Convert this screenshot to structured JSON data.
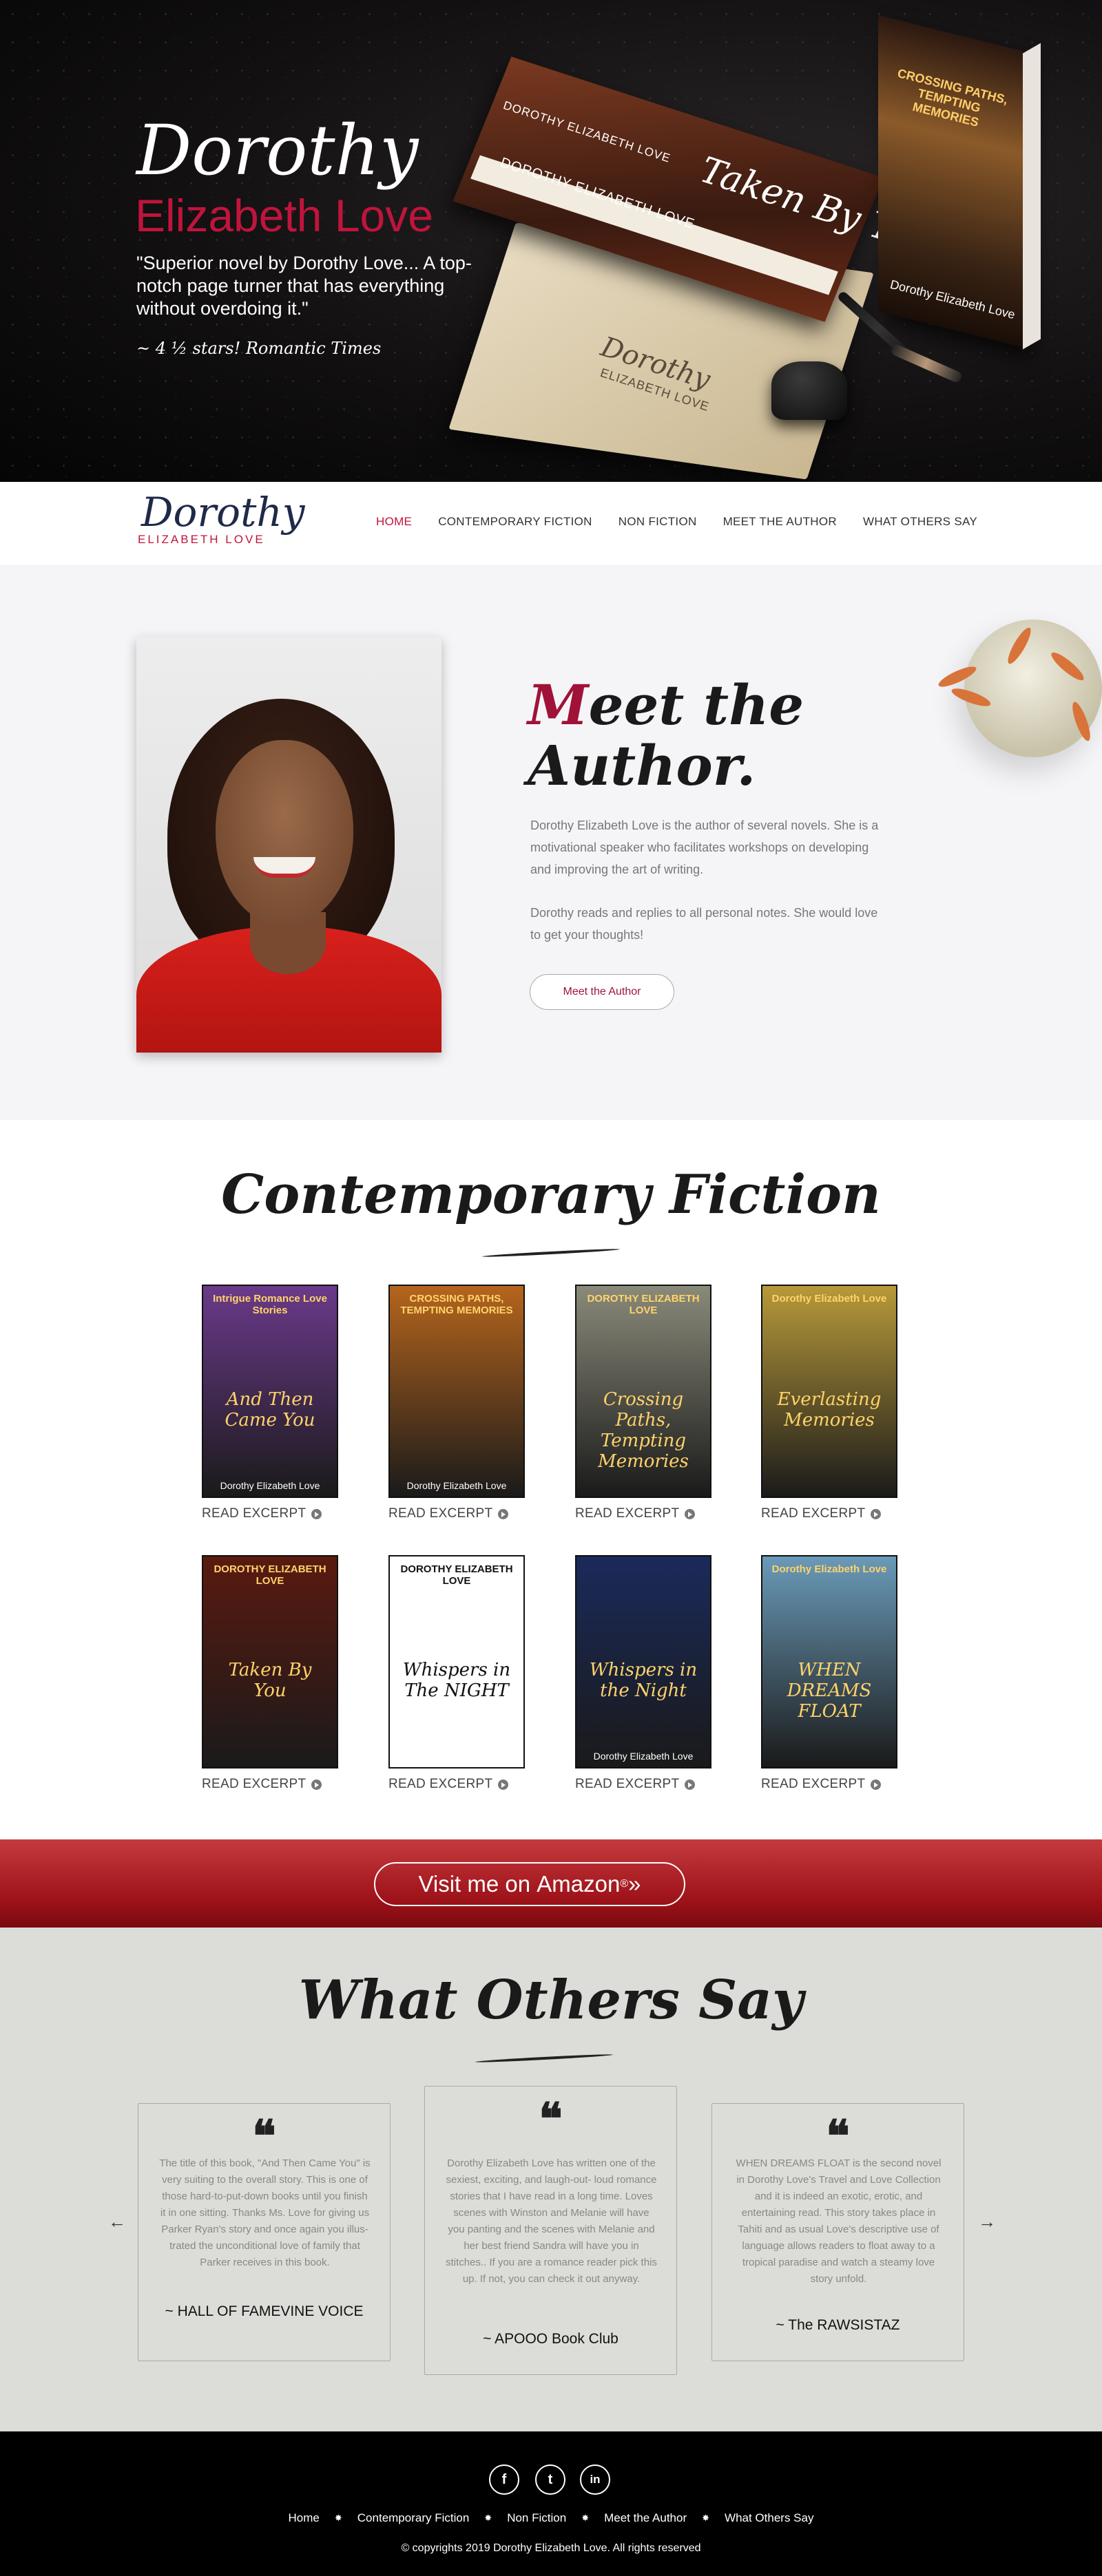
{
  "hero": {
    "title_line1": "Dorothy",
    "title_line2": "Elizabeth Love",
    "quote": "\"Superior novel by Dorothy Love... A top-notch page turner that has everything without overdoing it.\"",
    "citation": "~ 4 ½ stars! Romantic Times",
    "book_a_author_top": "DOROTHY ELIZABETH LOVE",
    "book_a_author_bottom": "DOROTHY ELIZABETH LOVE",
    "book_a_title": "Taken By You",
    "book_b_title": "CROSSING PATHS, TEMPTING MEMORIES",
    "book_b_author": "Dorothy Elizabeth Love",
    "envelope_sign": "Dorothy",
    "envelope_sub": "ELIZABETH LOVE"
  },
  "nav": {
    "logo_main": "Dorothy",
    "logo_sub": "ELIZABETH LOVE",
    "links": [
      "HOME",
      "CONTEMPORARY FICTION",
      "NON FICTION",
      "MEET THE AUTHOR",
      "WHAT OTHERS SAY"
    ],
    "active_index": 0
  },
  "meet": {
    "title_first_letter": "M",
    "title_rest_line1": "eet the",
    "title_line2": "Author.",
    "paragraph1": "Dorothy Elizabeth Love is the author of several novels. She is a motivational speaker who facilitates workshops on developing and improving the art of writing.",
    "paragraph2": "Dorothy reads and replies to all personal notes. She would love to get your thoughts!",
    "button_label": "Meet the Author"
  },
  "fiction": {
    "title": "Contemporary Fiction",
    "excerpt_label": "READ EXCERPT",
    "books": [
      {
        "top": "Intrigue Romance Love Stories",
        "title": "And Then Came You",
        "author": "Dorothy Elizabeth Love",
        "bg": "#6a3a8a"
      },
      {
        "top": "CROSSING PATHS, TEMPTING MEMORIES",
        "title": "",
        "author": "Dorothy Elizabeth Love",
        "bg": "#b5651d"
      },
      {
        "top": "DOROTHY ELIZABETH LOVE",
        "title": "Crossing Paths, Tempting Memories",
        "author": "",
        "bg": "#8a8a7a"
      },
      {
        "top": "Dorothy Elizabeth Love",
        "title": "Everlasting Memories",
        "author": "",
        "bg": "#b89a3a"
      },
      {
        "top": "DOROTHY ELIZABETH LOVE",
        "title": "Taken By You",
        "author": "",
        "bg": "#5a1a10"
      },
      {
        "top": "DOROTHY ELIZABETH LOVE",
        "title": "Whispers in The NIGHT",
        "author": "",
        "bg": "#ffffff"
      },
      {
        "top": "",
        "title": "Whispers in the Night",
        "author": "Dorothy Elizabeth Love",
        "bg": "#1a2a5a"
      },
      {
        "top": "Dorothy Elizabeth Love",
        "title": "WHEN DREAMS FLOAT",
        "author": "",
        "bg": "#6a9ab8"
      }
    ]
  },
  "amazon": {
    "prefix": "Visit me on ",
    "brand": "Amazon",
    "reg": "®",
    "suffix": " »"
  },
  "others": {
    "title": "What Others Say",
    "prev": "←",
    "next": "→",
    "testimonials": [
      {
        "text": "The title of this book, \"And Then Came You\" is very suiting to the overall story. This is one of those hard-to-put-down books until you finish it in one sitting. Thanks Ms. Love for giving us Parker Ryan's story and once again you illus-trated the unconditional love of family that Parker receives in this book.",
        "author": "~ HALL OF FAMEVINE VOICE"
      },
      {
        "text": "Dorothy Elizabeth Love has written one of the sexiest, exciting, and laugh-out- loud romance stories that I have read in a long time. Loves scenes with Winston and Melanie will have you panting and the scenes with Melanie and her best friend Sandra will have you in stitches.. If you are a romance reader pick this up. If not, you can check it out anyway.",
        "author": "~ APOOO Book Club"
      },
      {
        "text": "WHEN DREAMS FLOAT is the second novel in Dorothy Love's Travel and Love Collection and it is indeed an exotic, erotic, and entertaining read. This story takes place in Tahiti and as usual Love's descriptive use of language allows readers to float away to a tropical paradise and watch a steamy love story unfold.",
        "author": "~ The RAWSISTAZ"
      }
    ]
  },
  "footer": {
    "social": [
      "f",
      "t",
      "in"
    ],
    "links": [
      "Home",
      "Contemporary Fiction",
      "Non Fiction",
      "Meet the Author",
      "What Others Say"
    ],
    "separator": "✸",
    "copyright": "© copyrights 2019 Dorothy Elizabeth Love. All rights reserved"
  }
}
